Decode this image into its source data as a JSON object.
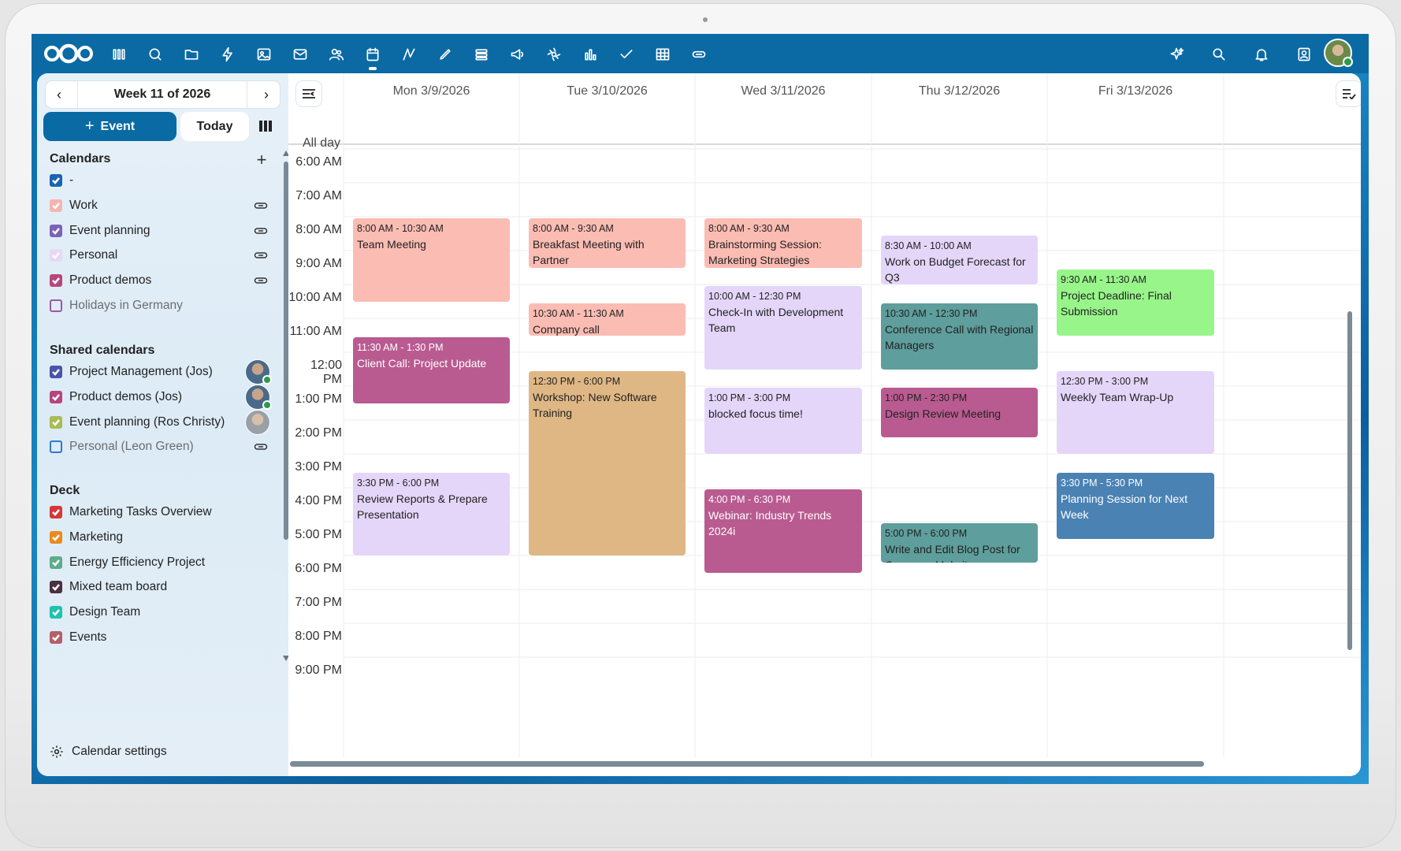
{
  "topbar": {
    "nav_icons": [
      "dashboard-icon",
      "search-circle-icon",
      "files-icon",
      "activity-icon",
      "photos-icon",
      "mail-icon",
      "contacts-icon",
      "calendar-icon",
      "text-icon",
      "notes-icon",
      "deck-icon",
      "announcements-icon",
      "integration-icon",
      "analytics-icon",
      "tasks-icon",
      "tables-icon",
      "link-icon"
    ],
    "right_icons": [
      "assistant-icon",
      "search-icon",
      "notifications-icon",
      "contacts-menu-icon"
    ],
    "active": "calendar-icon"
  },
  "sidebar": {
    "week_label": "Week 11 of 2026",
    "new_event": "Event",
    "today": "Today",
    "calendars_header": "Calendars",
    "calendars": [
      {
        "name": "-",
        "checked": true,
        "color": "#1a64b0",
        "shared_link": false
      },
      {
        "name": "Work",
        "checked": true,
        "color": "#f5b4ae",
        "shared_link": true
      },
      {
        "name": "Event planning",
        "checked": true,
        "color": "#7b62b8",
        "shared_link": true
      },
      {
        "name": "Personal",
        "checked": true,
        "color": "#e5d9f7",
        "shared_link": true
      },
      {
        "name": "Product demos",
        "checked": true,
        "color": "#b8457e",
        "shared_link": true
      },
      {
        "name": "Holidays in Germany",
        "checked": false,
        "color": "#9b5aa3",
        "shared_link": false
      }
    ],
    "shared_header": "Shared calendars",
    "shared": [
      {
        "name": "Project Management (Jos)",
        "checked": true,
        "color": "#4a54a8"
      },
      {
        "name": "Product demos (Jos)",
        "checked": true,
        "color": "#b8457e"
      },
      {
        "name": "Event planning (Ros Christy)",
        "checked": true,
        "color": "#a9bb54"
      },
      {
        "name": "Personal (Leon Green)",
        "checked": false,
        "color": "#2a7bd0"
      }
    ],
    "deck_header": "Deck",
    "deck": [
      {
        "name": "Marketing Tasks Overview",
        "color": "#d43838"
      },
      {
        "name": "Marketing",
        "color": "#e88b1f"
      },
      {
        "name": "Energy Efficiency Project",
        "color": "#5cad8c"
      },
      {
        "name": "Mixed team board",
        "color": "#4a3040"
      },
      {
        "name": "Design Team",
        "color": "#1fc1b0"
      },
      {
        "name": "Events",
        "color": "#b4606a"
      }
    ],
    "settings": "Calendar settings"
  },
  "grid": {
    "days": [
      "Mon 3/9/2026",
      "Tue 3/10/2026",
      "Wed 3/11/2026",
      "Thu 3/12/2026",
      "Fri 3/13/2026"
    ],
    "allday": "All day",
    "times": [
      "6:00 AM",
      "7:00 AM",
      "8:00 AM",
      "9:00 AM",
      "10:00 AM",
      "11:00 AM",
      "12:00 PM",
      "1:00 PM",
      "2:00 PM",
      "3:00 PM",
      "4:00 PM",
      "5:00 PM",
      "6:00 PM",
      "7:00 PM",
      "8:00 PM",
      "9:00 PM"
    ]
  },
  "events": [
    {
      "day": 0,
      "start": 8,
      "end": 10.5,
      "time": "8:00 AM - 10:30 AM",
      "title": "Team Meeting",
      "color": "#fbbcb3",
      "text": "#222"
    },
    {
      "day": 0,
      "start": 11.5,
      "end": 13.5,
      "time": "11:30 AM - 1:30 PM",
      "title": "Client Call: Project Update",
      "color": "#b95b90",
      "text": "#fff"
    },
    {
      "day": 0,
      "start": 15.5,
      "end": 18,
      "time": "3:30 PM - 6:00 PM",
      "title": "Review Reports & Prepare Presentation",
      "color": "#e4d6f9",
      "text": "#222"
    },
    {
      "day": 1,
      "start": 8,
      "end": 9.5,
      "time": "8:00 AM - 9:30 AM",
      "title": "Breakfast Meeting with Partner",
      "color": "#fbbcb3",
      "text": "#222"
    },
    {
      "day": 1,
      "start": 10.5,
      "end": 11.5,
      "time": "10:30 AM - 11:30 AM",
      "title": "Company call",
      "color": "#fbbcb3",
      "text": "#222"
    },
    {
      "day": 1,
      "start": 12.5,
      "end": 18,
      "time": "12:30 PM - 6:00 PM",
      "title": "Workshop: New Software Training",
      "color": "#dfb784",
      "text": "#222"
    },
    {
      "day": 2,
      "start": 8,
      "end": 9.5,
      "time": "8:00 AM - 9:30 AM",
      "title": "Brainstorming Session: Marketing Strategies",
      "color": "#fbbcb3",
      "text": "#222"
    },
    {
      "day": 2,
      "start": 10,
      "end": 12.5,
      "time": "10:00 AM - 12:30 PM",
      "title": "Check-In with Development Team",
      "color": "#e4d6f9",
      "text": "#222"
    },
    {
      "day": 2,
      "start": 13,
      "end": 15,
      "time": "1:00 PM - 3:00 PM",
      "title": "blocked focus time!",
      "color": "#e4d6f9",
      "text": "#222"
    },
    {
      "day": 2,
      "start": 16,
      "end": 18.5,
      "time": "4:00 PM - 6:30 PM",
      "title": "Webinar: Industry Trends 2024i",
      "color": "#b95b90",
      "text": "#fff"
    },
    {
      "day": 3,
      "start": 8.5,
      "end": 10,
      "time": "8:30 AM - 10:00 AM",
      "title": "Work on Budget Forecast for Q3",
      "color": "#e4d6f9",
      "text": "#222"
    },
    {
      "day": 3,
      "start": 10.5,
      "end": 12.5,
      "time": "10:30 AM - 12:30 PM",
      "title": "Conference Call with Regional Managers",
      "color": "#5e9e9c",
      "text": "#222"
    },
    {
      "day": 3,
      "start": 13,
      "end": 14.5,
      "time": "1:00 PM - 2:30 PM",
      "title": "Design Review Meeting",
      "color": "#b95b90",
      "text": "#222"
    },
    {
      "day": 3,
      "start": 17,
      "end": 18.2,
      "time": "5:00 PM - 6:00 PM",
      "title": "Write and Edit Blog Post for Camnany Mahcita",
      "color": "#5e9e9c",
      "text": "#222"
    },
    {
      "day": 4,
      "start": 9.5,
      "end": 11.5,
      "time": "9:30 AM - 11:30 AM",
      "title": "Project Deadline: Final Submission",
      "color": "#98f58a",
      "text": "#222"
    },
    {
      "day": 4,
      "start": 12.5,
      "end": 15,
      "time": "12:30 PM - 3:00 PM",
      "title": "Weekly Team Wrap-Up",
      "color": "#e4d6f9",
      "text": "#222"
    },
    {
      "day": 4,
      "start": 15.5,
      "end": 17.5,
      "time": "3:30 PM - 5:30 PM",
      "title": "Planning Session for Next Week",
      "color": "#4a82b4",
      "text": "#fff"
    }
  ]
}
